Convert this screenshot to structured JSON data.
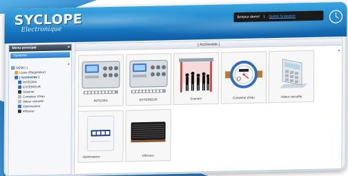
{
  "brand": {
    "name": "SYCLOPE",
    "tagline": "Electronique"
  },
  "user": {
    "greeting": "Bonjour demo!",
    "separator": "|",
    "logout": "Quitter la session"
  },
  "sidebar": {
    "title": "Menu principal",
    "tab": "Systeme",
    "tree": [
      {
        "label": "DEMO 1",
        "level": 0,
        "icon": "home-icon"
      },
      {
        "label": "Usine (Regulateur)",
        "level": 1,
        "icon": "folder-icon"
      },
      {
        "label": "[ Archimède ]",
        "level": 1,
        "icon": "device-icon",
        "selected": true
      },
      {
        "label": "INTEGRA",
        "level": 2,
        "icon": "controller-icon"
      },
      {
        "label": "EXTERIEUR",
        "level": 2,
        "icon": "controller-icon"
      },
      {
        "label": "Scanner",
        "level": 2,
        "icon": "people-icon"
      },
      {
        "label": "Compteur d'eau",
        "level": 2,
        "icon": "meter-icon"
      },
      {
        "label": "Valeur calculée",
        "level": 2,
        "icon": "calc-icon"
      },
      {
        "label": "Optimisateur",
        "level": 2,
        "icon": "optimizer-icon"
      },
      {
        "label": "effisseur",
        "level": 2,
        "icon": "heater-icon"
      }
    ]
  },
  "main": {
    "title": "[ Archimède ]",
    "tiles": [
      {
        "label": "INTEGRA",
        "icon": "controller-icon"
      },
      {
        "label": "EXTERIEUR",
        "icon": "controller-icon"
      },
      {
        "label": "Scanner",
        "icon": "people-icon"
      },
      {
        "label": "Compteur d'eau",
        "icon": "water-meter-icon"
      },
      {
        "label": "Valeur calculée",
        "icon": "calculator-icon"
      },
      {
        "label": "Optimisateur",
        "icon": "optimizer-icon"
      },
      {
        "label": "effisseur",
        "icon": "heater-icon"
      }
    ]
  },
  "colors": {
    "header": "#1b7fc7",
    "accent": "#2c7bc7",
    "link": "#4ea3ff"
  }
}
